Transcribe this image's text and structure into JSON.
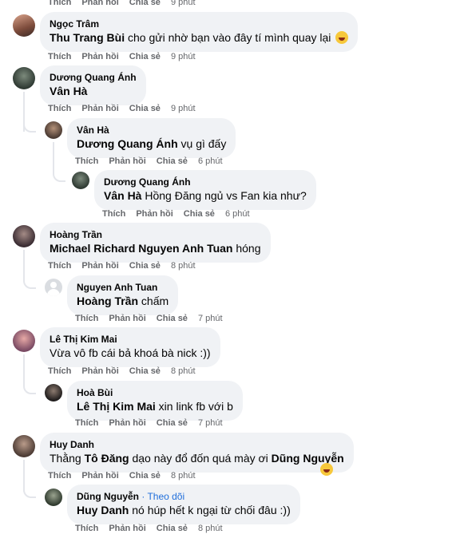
{
  "top_partial": {
    "like": "Thích",
    "reply": "Phản hồi",
    "share": "Chia sẻ",
    "time": "9 phút"
  },
  "comments": [
    {
      "author": "Ngọc Trâm",
      "mention": "Thu Trang Bùi",
      "text": " cho gửi nhờ bạn vào đây tí mình quay lại ",
      "emoji": "rolling-laughing-emoji",
      "like": "Thích",
      "reply": "Phản hồi",
      "share": "Chia sẻ",
      "time": "9 phút"
    },
    {
      "author": "Dương Quang Ánh",
      "mention": "Vân Hà",
      "text": "",
      "like": "Thích",
      "reply": "Phản hồi",
      "share": "Chia sẻ",
      "time": "9 phút",
      "replies": [
        {
          "author": "Vân Hà",
          "mention": "Dương Quang Ánh",
          "text": " vụ gì đấy",
          "like": "Thích",
          "reply": "Phản hồi",
          "share": "Chia sẻ",
          "time": "6 phút"
        },
        {
          "author": "Dương Quang Ánh",
          "mention": "Vân Hà",
          "text": " Hồng Đăng ngủ vs Fan kia như?",
          "like": "Thích",
          "reply": "Phản hồi",
          "share": "Chia sẻ",
          "time": "6 phút"
        }
      ]
    },
    {
      "author": "Hoàng Trần",
      "mention": "Michael Richard Nguyen Anh Tuan",
      "text": " hóng",
      "like": "Thích",
      "reply": "Phản hồi",
      "share": "Chia sẻ",
      "time": "8 phút",
      "replies": [
        {
          "author": "Nguyen Anh Tuan",
          "mention": "Hoàng Trần",
          "text": " chấm",
          "like": "Thích",
          "reply": "Phản hồi",
          "share": "Chia sẻ",
          "time": "7 phút"
        }
      ]
    },
    {
      "author": "Lê Thị Kim Mai",
      "mention": "",
      "text": "Vừa vô fb cái bả khoá bà nick :))",
      "like": "Thích",
      "reply": "Phản hồi",
      "share": "Chia sẻ",
      "time": "8 phút",
      "replies": [
        {
          "author": "Hoà Bùi",
          "mention": "Lê Thị Kim Mai",
          "text": " xin link fb với b",
          "like": "Thích",
          "reply": "Phản hồi",
          "share": "Chia sẻ",
          "time": "7 phút"
        }
      ]
    },
    {
      "author": "Huy Danh",
      "text_pre": "Thằng ",
      "mention": "Tô Đăng",
      "text": " dạo này đổ đốn quá mày ơi ",
      "mention2": "Dũng Nguyễn",
      "emoji": "grinning-sweat-emoji",
      "like": "Thích",
      "reply": "Phản hồi",
      "share": "Chia sẻ",
      "time": "8 phút",
      "replies": [
        {
          "author": "Dũng Nguyễn",
          "follow": " · Theo dõi",
          "mention": "Huy Danh",
          "text": " nó húp hết k ngại từ chối đâu :))",
          "like": "Thích",
          "reply": "Phản hồi",
          "share": "Chia sẻ",
          "time": "8 phút"
        }
      ]
    }
  ],
  "colors": {
    "bubble": "#f0f2f5",
    "meta": "#65676b",
    "link": "#216fdb",
    "thread": "#e4e6eb"
  }
}
